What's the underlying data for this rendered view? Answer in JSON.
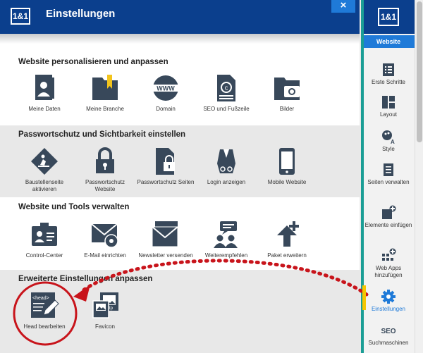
{
  "dialog": {
    "logo": "1&1",
    "title": "Einstellungen",
    "close": "×"
  },
  "sections": [
    {
      "title": "Website personalisieren und anpassen",
      "items": [
        {
          "label": "Meine Daten",
          "icon": "person-card-icon"
        },
        {
          "label": "Meine Branche",
          "icon": "folder-bookmark-icon"
        },
        {
          "label": "Domain",
          "icon": "globe-www-icon"
        },
        {
          "label": "SEO und Fußzeile",
          "icon": "document-copyright-icon"
        },
        {
          "label": "Bilder",
          "icon": "folder-camera-icon"
        }
      ]
    },
    {
      "title": "Passwortschutz und Sichtbarkeit einstellen",
      "items": [
        {
          "label": "Baustellenseite aktivieren",
          "icon": "construction-sign-icon"
        },
        {
          "label": "Passwortschutz Website",
          "icon": "lock-icon"
        },
        {
          "label": "Passwortschutz Seiten",
          "icon": "document-lock-icon"
        },
        {
          "label": "Login anzeigen",
          "icon": "user-glasses-icon"
        },
        {
          "label": "Mobile Website",
          "icon": "tablet-icon"
        }
      ]
    },
    {
      "title": "Website und Tools verwalten",
      "items": [
        {
          "label": "Control-Center",
          "icon": "id-card-icon"
        },
        {
          "label": "E-Mail einrichten",
          "icon": "envelope-gear-icon"
        },
        {
          "label": "Newsletter versenden",
          "icon": "envelope-stack-icon"
        },
        {
          "label": "Weiterempfehlen",
          "icon": "speech-users-icon"
        },
        {
          "label": "Paket erweitern",
          "icon": "arrow-up-plus-icon"
        }
      ]
    },
    {
      "title": "Erweiterte Einstellungen anpassen",
      "items": [
        {
          "label": "Head bearbeiten",
          "icon": "head-tag-edit-icon",
          "icon_text": "<head>"
        },
        {
          "label": "Favicon",
          "icon": "image-http-icon",
          "icon_text": "http"
        }
      ]
    }
  ],
  "sidebar": {
    "logo": "1&1",
    "tab": "Website",
    "items": [
      {
        "label": "Erste Schritte",
        "icon": "checklist-icon"
      },
      {
        "label": "Layout",
        "icon": "layout-icon"
      },
      {
        "label": "Style",
        "icon": "style-brush-icon"
      },
      {
        "label": "Seiten verwalten",
        "icon": "pages-icon"
      },
      {
        "label": "Elemente einfügen",
        "icon": "elements-add-icon"
      },
      {
        "label": "Web Apps hinzufügen",
        "icon": "apps-add-icon"
      },
      {
        "label": "Einstellungen",
        "icon": "gear-icon",
        "active": true
      },
      {
        "label": "Suchmaschinen",
        "icon": "seo-icon",
        "icon_text": "SEO"
      }
    ]
  },
  "colors": {
    "header": "#0b3f8d",
    "accent": "#1f7ad8",
    "icon": "#38485a",
    "annotation": "#c8141b"
  }
}
